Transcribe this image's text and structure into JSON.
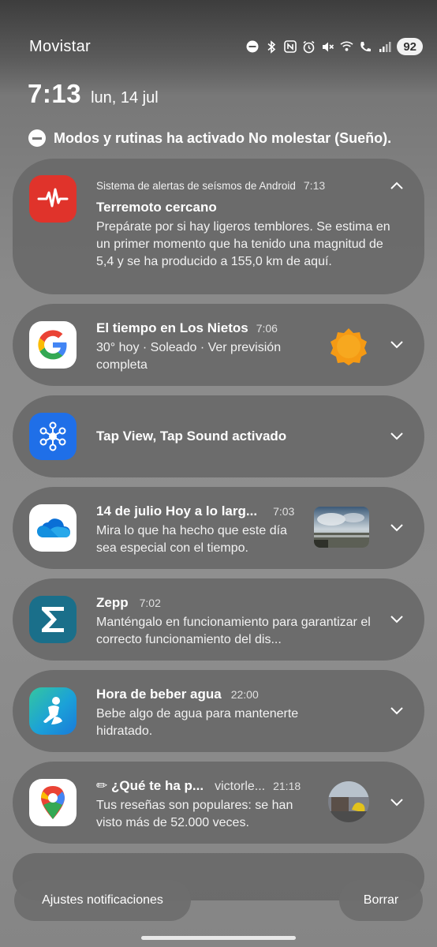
{
  "status_bar": {
    "carrier": "Movistar",
    "battery": "92",
    "icons": [
      "dnd-icon",
      "bluetooth-icon",
      "nfc-icon",
      "alarm-icon",
      "mute-icon",
      "wifi-calling-icon",
      "volte-icon",
      "signal-icon"
    ]
  },
  "lock": {
    "time": "7:13",
    "date": "lun, 14 jul",
    "dnd_message": "Modos y rutinas ha activado No molestar (Sueño)."
  },
  "notifications": [
    {
      "app": "Sistema de alertas de seísmos de Android",
      "time": "7:13",
      "title": "Terremoto cercano",
      "body": "Prepárate por si hay ligeros temblores. Se estima en un primer momento que ha tenido una magnitud de 5,4 y se ha producido a 155,0 km de aquí.",
      "icon": "earthquake-alert-icon",
      "accent": "#e0332b"
    },
    {
      "title": "El tiempo en Los Nietos",
      "time": "7:06",
      "body": "30° hoy · Soleado · Ver previsión completa",
      "icon": "google-icon"
    },
    {
      "title": "Tap View, Tap Sound activado",
      "icon": "samsung-hub-icon",
      "accent": "#1f6fe8"
    },
    {
      "title": "14 de julio Hoy a lo larg...",
      "time": "7:03",
      "body": "Mira lo que ha hecho que este día sea especial con el tiempo.",
      "icon": "onedrive-icon"
    },
    {
      "title": "Zepp",
      "time": "7:02",
      "body": "Manténgalo en funcionamiento para garantizar el correcto funcionamiento del dis...",
      "icon": "zepp-icon",
      "accent": "#1a6f8a"
    },
    {
      "title": "Hora de beber agua",
      "time": "22:00",
      "body": "Bebe algo de agua para mantenerte hidratado.",
      "icon": "samsung-health-icon"
    },
    {
      "title": "✏ ¿Qué te ha p...",
      "sender": "victorle...",
      "time": "21:18",
      "body": "Tus reseñas son populares: se han visto más de 52.000 veces.",
      "icon": "google-maps-icon"
    }
  ],
  "actions": {
    "settings": "Ajustes notificaciones",
    "clear": "Borrar"
  }
}
